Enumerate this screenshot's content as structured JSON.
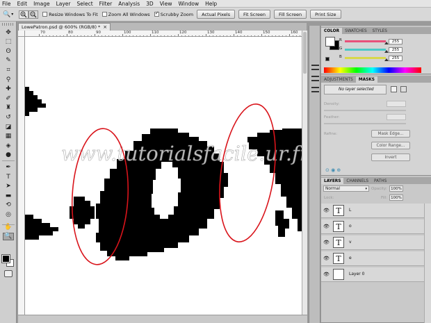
{
  "menu": [
    "File",
    "Edit",
    "Image",
    "Layer",
    "Select",
    "Filter",
    "Analysis",
    "3D",
    "View",
    "Window",
    "Help"
  ],
  "options_bar": {
    "zoom_glyph": "🔍",
    "zoom_arrow": "▾",
    "checks": [
      {
        "label": "Resize Windows To Fit",
        "checked": false
      },
      {
        "label": "Zoom All Windows",
        "checked": false
      },
      {
        "label": "Scrubby Zoom",
        "checked": true
      }
    ],
    "buttons": [
      "Actual Pixels",
      "Fit Screen",
      "Fill Screen",
      "Print Size"
    ]
  },
  "document": {
    "tab_title": "LowePatron.psd @ 600% (RGB/8) *",
    "close": "×",
    "ruler_labels": [
      "70",
      "80",
      "90",
      "100",
      "110",
      "120",
      "130",
      "140",
      "150",
      "160"
    ],
    "watermark": "www.tutorialsfacile.ur.fr"
  },
  "color_panel": {
    "tabs": [
      "COLOR",
      "SWATCHES",
      "STYLES"
    ],
    "channels": [
      {
        "label": "R",
        "value": "255",
        "color": "#e8507a"
      },
      {
        "label": "G",
        "value": "255",
        "color": "#4ac9c6"
      },
      {
        "label": "B",
        "value": "255",
        "color": "#d8d84a"
      }
    ]
  },
  "adjustments_panel": {
    "tabs": [
      "ADJUSTMENTS",
      "MASKS"
    ],
    "no_layer": "No layer selected",
    "density_label": "Density:",
    "feather_label": "Feather:",
    "refine_label": "Refine:",
    "buttons": [
      "Mask Edge...",
      "Color Range...",
      "Invert"
    ]
  },
  "layers_panel": {
    "tabs": [
      "LAYERS",
      "CHANNELS",
      "PATHS"
    ],
    "blend_mode": "Normal",
    "opacity_label": "Opacity:",
    "opacity": "100%",
    "lock_label": "Lock:",
    "fill_label": "Fill:",
    "fill": "100%",
    "eye": "👁",
    "text_thumb": "T",
    "layers": [
      {
        "name": "L",
        "type": "text"
      },
      {
        "name": "o",
        "type": "text"
      },
      {
        "name": "v",
        "type": "text"
      },
      {
        "name": "e",
        "type": "text"
      },
      {
        "name": "Layer 0",
        "type": "pixel"
      }
    ]
  },
  "tools": [
    {
      "icon": "move-tool-icon",
      "glyph": "✥"
    },
    {
      "icon": "marquee-tool-icon",
      "glyph": "⬚"
    },
    {
      "icon": "lasso-tool-icon",
      "glyph": "ʘ"
    },
    {
      "icon": "quick-select-tool-icon",
      "glyph": "✎"
    },
    {
      "icon": "crop-tool-icon",
      "glyph": "⌗"
    },
    {
      "icon": "eyedropper-tool-icon",
      "glyph": "⚲"
    },
    {
      "icon": "healing-brush-icon",
      "glyph": "✚"
    },
    {
      "icon": "brush-tool-icon",
      "glyph": "✐"
    },
    {
      "icon": "clone-stamp-icon",
      "glyph": "♜"
    },
    {
      "icon": "history-brush-icon",
      "glyph": "↺"
    },
    {
      "icon": "eraser-tool-icon",
      "glyph": "◪"
    },
    {
      "icon": "gradient-tool-icon",
      "glyph": "▦"
    },
    {
      "icon": "blur-tool-icon",
      "glyph": "◈"
    },
    {
      "icon": "dodge-tool-icon",
      "glyph": "●"
    },
    {
      "icon": "pen-tool-icon",
      "glyph": "✒"
    },
    {
      "icon": "type-tool-icon",
      "glyph": "T"
    },
    {
      "icon": "path-select-icon",
      "glyph": "➤"
    },
    {
      "icon": "shape-tool-icon",
      "glyph": "▬"
    },
    {
      "icon": "3d-rotate-icon",
      "glyph": "⟲"
    },
    {
      "icon": "3d-orbit-icon",
      "glyph": "◎"
    },
    {
      "icon": "hand-tool-icon",
      "glyph": "✋"
    },
    {
      "icon": "zoom-tool-icon",
      "glyph": "🔍"
    }
  ]
}
